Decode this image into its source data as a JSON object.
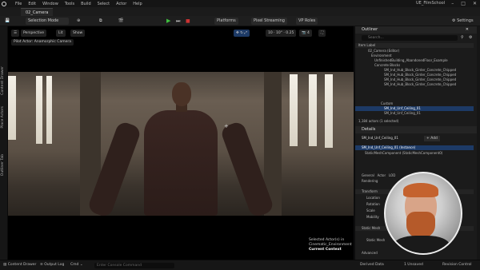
{
  "menubar": {
    "items": [
      "File",
      "Edit",
      "Window",
      "Tools",
      "Build",
      "Select",
      "Actor",
      "Help"
    ],
    "project": "UE_FilmSchool"
  },
  "tab": {
    "label": "02_Camera"
  },
  "toolbar": {
    "selection_mode": "Selection Mode",
    "platforms": "Platforms",
    "pixel_streaming": "Pixel Streaming",
    "vp_roles": "VP Roles",
    "settings": "Settings"
  },
  "left_strip": [
    "Content Drawer",
    "Place Actors",
    "Outliner Tab"
  ],
  "viewport": {
    "perspective": "Perspective",
    "lit": "Lit",
    "show": "Show",
    "pilot": "Pilot Actor: Anamorphic Camera",
    "selected_actors": "Selected Actor(s) in",
    "level": "Cinematic_Environment",
    "current_context": "Current Context"
  },
  "outliner": {
    "title": "Outliner",
    "search_placeholder": "Search...",
    "col_label": "Item Label",
    "rows": [
      "02_Camera (Editor)",
      "Environment",
      "UnfinishedBuilding_AbandonedFloor_Example",
      "Concrete Blocks",
      "SM_Ind_Hub_Block_Girder_Concrete_Chipped",
      "SM_Ind_Hub_Block_Girder_Concrete_Chipped",
      "SM_Ind_Hub_Block_Girder_Concrete_Chipped",
      "SM_Ind_Hub_Block_Girder_Concrete_Chipped",
      "Custom",
      "SM_Ind_Unf_Ceiling_01",
      "SM_Ind_Unf_Ceiling_01"
    ],
    "footer": "1,184 actors (1 selected)"
  },
  "details": {
    "title": "Details",
    "object": "SM_Ind_Unf_Ceiling_01",
    "instance": "SM_Ind_Unf_Ceiling_01 (Instance)",
    "component": "StaticMeshComponent (StaticMeshComponent0)",
    "add_label": "+ Add",
    "edit_in": "Edit in C++",
    "tabs": [
      "General",
      "Actor",
      "LOD",
      "Misc",
      "Physics",
      "Streaming",
      "Rendering"
    ],
    "sections": [
      "Transform",
      "Location",
      "Rotation",
      "Scale",
      "Mobility",
      "Static Mesh",
      "Static Mesh",
      "Advanced"
    ]
  },
  "statusbar": {
    "content_drawer": "Content Drawer",
    "output_log": "Output Log",
    "cmd": "Cmd",
    "console_placeholder": "Enter Console Command",
    "derived_data": "Derived Data",
    "unsaved": "1 Unsaved",
    "revision_control": "Revision Control"
  },
  "colors": {
    "accent_blue": "#1d3a66",
    "play_green": "#3fbf3f"
  }
}
